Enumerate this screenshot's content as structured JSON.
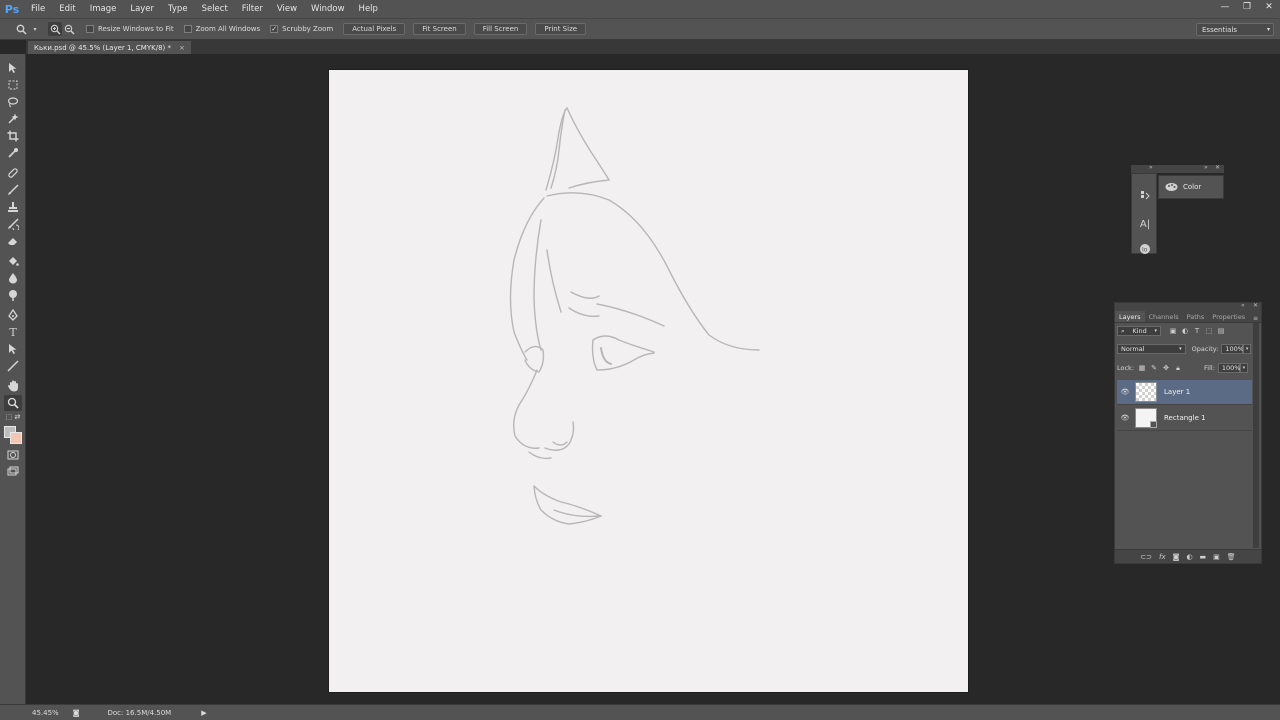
{
  "app": {
    "logo": "Ps"
  },
  "menu": [
    "File",
    "Edit",
    "Image",
    "Layer",
    "Type",
    "Select",
    "Filter",
    "View",
    "Window",
    "Help"
  ],
  "window_controls": {
    "minimize": "—",
    "restore": "❐",
    "close": "✕"
  },
  "options": {
    "resize_windows_label": "Resize Windows to Fit",
    "zoom_all_label": "Zoom All Windows",
    "scrubby_zoom_label": "Scrubby Zoom",
    "scrubby_zoom_checked": true,
    "buttons": [
      "Actual Pixels",
      "Fit Screen",
      "Fill Screen",
      "Print Size"
    ],
    "workspace": "Essentials"
  },
  "document": {
    "tab_title": "Кьки.psd @ 45.5% (Layer 1, CMYK/8) *",
    "close": "×"
  },
  "status": {
    "zoom": "45.45%",
    "doc_size": "Doc: 16.5M/4.50M",
    "arrow": "▶"
  },
  "dock": {
    "color_label": "Color"
  },
  "layers_panel": {
    "tabs": [
      "Layers",
      "Channels",
      "Paths",
      "Properties"
    ],
    "filter_kind": "Kind",
    "blend_mode": "Normal",
    "opacity_label": "Opacity:",
    "opacity_value": "100%",
    "lock_label": "Lock:",
    "fill_label": "Fill:",
    "fill_value": "100%",
    "layers": [
      {
        "name": "Layer 1",
        "selected": true
      },
      {
        "name": "Rectangle 1",
        "selected": false
      }
    ]
  },
  "colors": {
    "foreground": "#bdbdbd",
    "background": "#f2c6b2",
    "canvas": "#f2f0f1",
    "selection": "#5c6b85"
  }
}
